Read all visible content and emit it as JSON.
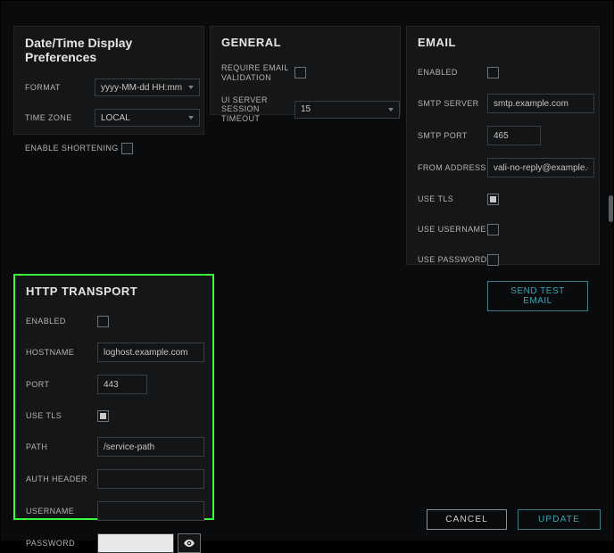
{
  "date": {
    "title": "Date/Time Display Preferences",
    "format_label": "FORMAT",
    "format_value": "yyyy-MM-dd HH:mm",
    "tz_label": "TIME ZONE",
    "tz_value": "LOCAL",
    "shorten_label": "ENABLE SHORTENING",
    "shorten_checked": false
  },
  "general": {
    "title": "GENERAL",
    "require_email_label": "REQUIRE EMAIL VALIDATION",
    "require_email_checked": false,
    "ui_timeout_label": "UI SERVER SESSION TIMEOUT",
    "ui_timeout_value": "15"
  },
  "email": {
    "title": "EMAIL",
    "enabled_label": "ENABLED",
    "enabled_checked": false,
    "server_label": "SMTP SERVER",
    "server_value": "smtp.example.com",
    "port_label": "SMTP PORT",
    "port_value": "465",
    "from_label": "FROM ADDRESS",
    "from_value": "vali-no-reply@example.com",
    "tls_label": "USE TLS",
    "tls_checked": true,
    "use_user_label": "USE USERNAME",
    "use_user_checked": false,
    "use_pass_label": "USE PASSWORD",
    "use_pass_checked": false,
    "send_test_label": "SEND TEST EMAIL"
  },
  "http": {
    "title": "HTTP TRANSPORT",
    "enabled_label": "ENABLED",
    "enabled_checked": false,
    "host_label": "HOSTNAME",
    "host_value": "loghost.example.com",
    "port_label": "PORT",
    "port_value": "443",
    "tls_label": "USE TLS",
    "tls_checked": true,
    "path_label": "PATH",
    "path_value": "/service-path",
    "auth_label": "AUTH HEADER",
    "auth_value": "",
    "user_label": "USERNAME",
    "user_value": "",
    "pass_label": "PASSWORD",
    "pass_value": ""
  },
  "footer": {
    "cancel": "CANCEL",
    "update": "UPDATE"
  }
}
